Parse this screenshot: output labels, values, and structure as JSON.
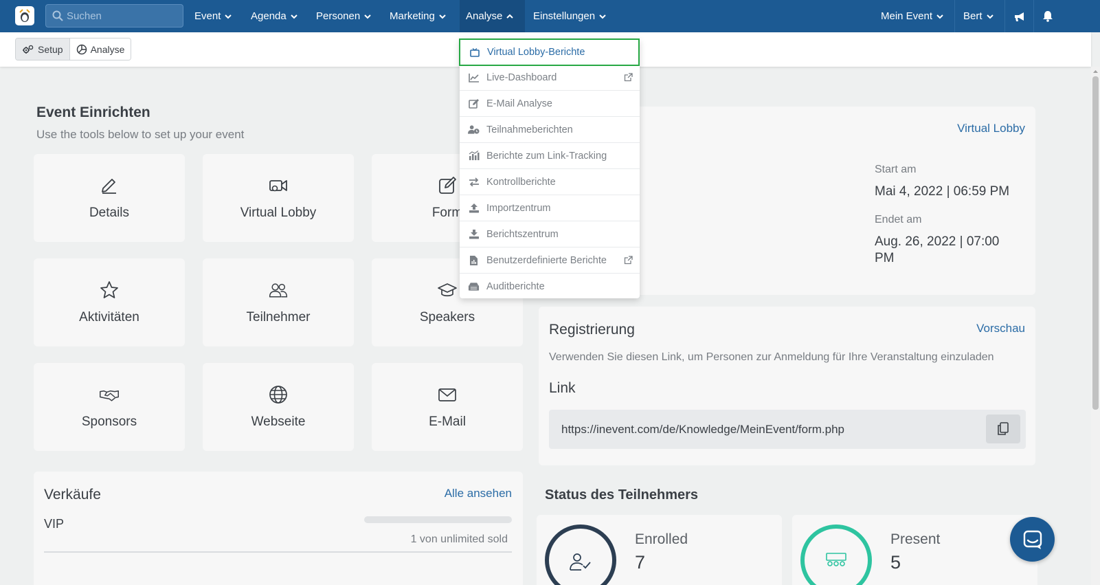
{
  "nav": {
    "search_placeholder": "Suchen",
    "items": [
      {
        "label": "Event"
      },
      {
        "label": "Agenda"
      },
      {
        "label": "Personen"
      },
      {
        "label": "Marketing"
      },
      {
        "label": "Analyse"
      },
      {
        "label": "Einstellungen"
      }
    ],
    "event_menu": "Mein Event",
    "user_menu": "Bert"
  },
  "subbar": {
    "setup_label": "Setup",
    "analyse_label": "Analyse"
  },
  "setup": {
    "title": "Event Einrichten",
    "subtitle": "Use the tools below to set up your event",
    "tiles": [
      {
        "label": "Details",
        "icon": "pencil-icon"
      },
      {
        "label": "Virtual Lobby",
        "icon": "video-camera-icon"
      },
      {
        "label": "Form",
        "icon": "edit-form-icon"
      },
      {
        "label": "Aktivitäten",
        "icon": "star-icon"
      },
      {
        "label": "Teilnehmer",
        "icon": "users-icon"
      },
      {
        "label": "Speakers",
        "icon": "graduation-cap-icon"
      },
      {
        "label": "Sponsors",
        "icon": "handshake-icon"
      },
      {
        "label": "Webseite",
        "icon": "globe-icon"
      },
      {
        "label": "E-Mail",
        "icon": "envelope-icon"
      }
    ]
  },
  "sales": {
    "title": "Verkäufe",
    "view_all": "Alle ansehen",
    "ticket_name": "VIP",
    "sold_text": "1 von unlimited sold"
  },
  "event_info": {
    "virtual_lobby_link": "Virtual Lobby",
    "start_label": "Start am",
    "start_value": "Mai 4, 2022 | 06:59 PM",
    "end_label": "Endet am",
    "end_value": "Aug. 26, 2022 | 07:00 PM"
  },
  "registration": {
    "title": "Registrierung",
    "preview": "Vorschau",
    "description": "Verwenden Sie diesen Link, um Personen zur Anmeldung für Ihre Veranstaltung einzuladen",
    "link_title": "Link",
    "url": "https://inevent.com/de/Knowledge/MeinEvent/form.php"
  },
  "attendee_status": {
    "title": "Status des Teilnehmers",
    "cards": [
      {
        "label": "Enrolled",
        "value": "7"
      },
      {
        "label": "Present",
        "value": "5"
      }
    ]
  },
  "analyse_menu": {
    "items": [
      {
        "label": "Virtual Lobby-Berichte",
        "icon": "tv-icon"
      },
      {
        "label": "Live-Dashboard",
        "icon": "line-chart-icon"
      },
      {
        "label": "E-Mail Analyse",
        "icon": "edit-icon"
      },
      {
        "label": "Teilnahmeberichten",
        "icon": "user-clock-icon"
      },
      {
        "label": "Berichte zum Link-Tracking",
        "icon": "bar-chart-icon"
      },
      {
        "label": "Kontrollberichte",
        "icon": "exchange-icon"
      },
      {
        "label": "Importzentrum",
        "icon": "upload-icon"
      },
      {
        "label": "Berichtszentrum",
        "icon": "download-icon"
      },
      {
        "label": "Benutzerdefinierte Berichte",
        "icon": "file-report-icon"
      },
      {
        "label": "Auditberichte",
        "icon": "archive-icon"
      }
    ]
  },
  "colors": {
    "nav_bg": "#1c5a93",
    "link": "#2b6ca6",
    "highlight": "#27a844",
    "present_ring": "#2ec4a0"
  }
}
